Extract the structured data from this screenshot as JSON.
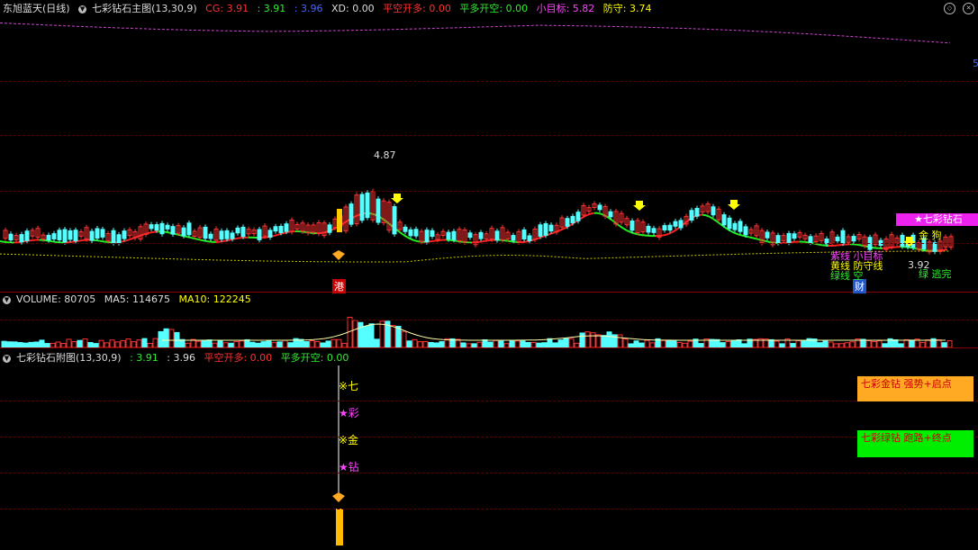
{
  "main": {
    "stock": "东旭蓝天",
    "period": "(日线)",
    "indicator": "七彩钻石主图(13,30,9)",
    "cg": "CG: 3.91",
    "v1": ": 3.91",
    "v2": ": 3.96",
    "xd": "XD: 0.00",
    "pkkd": "平空开多: 0.00",
    "pdkk": "平多开空: 0.00",
    "target": "小目标: 5.82",
    "defend": "防守: 3.74",
    "peak_label": "4.87",
    "low_label": "3.92",
    "right_edge_label": "5",
    "gang_label": "港",
    "cai_label": "财",
    "star_banner": "★七彩钻石",
    "annotations": [
      {
        "text": "紫线 小目标",
        "color": "#ff44ff"
      },
      {
        "text": "黄线 防守线",
        "color": "#ffff00"
      },
      {
        "text": "绿线 空",
        "color": "#33ee33"
      },
      {
        "text": "金 狗",
        "color": "#ffff00"
      },
      {
        "text": "绿 逃完",
        "color": "#33ee33"
      }
    ]
  },
  "volume": {
    "label": "VOLUME: 80705",
    "ma5": "MA5: 114675",
    "ma10": "MA10: 122245"
  },
  "sub": {
    "indicator": "七彩钻石附图(13,30,9)",
    "v1": ": 3.91",
    "v2": ": 3.96",
    "pkkd": "平空开多: 0.00",
    "pdkk": "平多开空: 0.00",
    "vchars": [
      {
        "text": "※七",
        "color": "#ffff00"
      },
      {
        "text": "★彩",
        "color": "#ff44ff"
      },
      {
        "text": "※金",
        "color": "#ffff00"
      },
      {
        "text": "★钻",
        "color": "#ff44ff"
      }
    ],
    "legend_orange": "七彩金钻 强势+启点",
    "legend_green": "七彩绿钻 跑路+终点"
  },
  "colors": {
    "up": "#ff3333",
    "down": "#55ffff",
    "ma_red": "#ff2020",
    "ma_green": "#22ee22",
    "purple": "#cc44cc",
    "yellow": "#ffff00",
    "orange": "#ffaa22",
    "grid": "#5a0000"
  }
}
